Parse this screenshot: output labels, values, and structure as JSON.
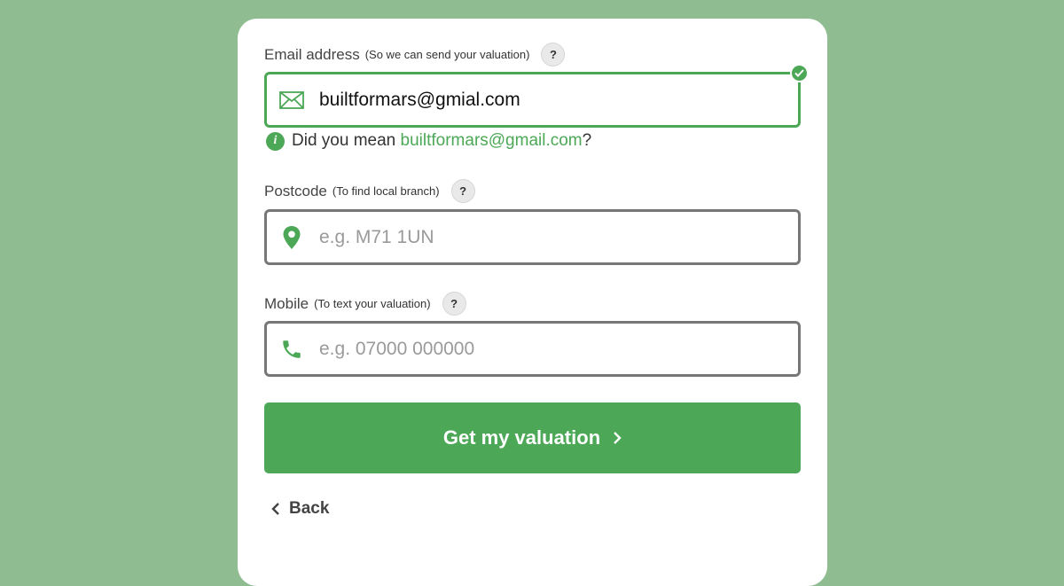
{
  "colors": {
    "page_background": "#8fbc91",
    "accent_green": "#4ca857",
    "input_border": "#777777",
    "placeholder": "#9a9a9a"
  },
  "email": {
    "label": "Email address",
    "hint": "(So we can send your valuation)",
    "help": "?",
    "value": "builtformars@gmial.com",
    "icon": "envelope-icon",
    "status": "valid",
    "suggestion_prefix": "Did you mean ",
    "suggestion_link": "builtformars@gmail.com",
    "suggestion_suffix": "?"
  },
  "postcode": {
    "label": "Postcode",
    "hint": "(To find local branch)",
    "help": "?",
    "placeholder": "e.g. M71 1UN",
    "icon": "map-pin-icon"
  },
  "mobile": {
    "label": "Mobile",
    "hint": "(To text your valuation)",
    "help": "?",
    "placeholder": "e.g. 07000 000000",
    "icon": "phone-icon"
  },
  "actions": {
    "submit_label": "Get my valuation",
    "back_label": "Back"
  }
}
